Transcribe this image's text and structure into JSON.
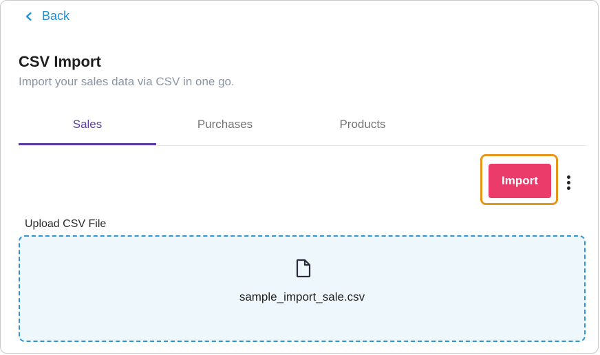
{
  "nav": {
    "back_label": "Back"
  },
  "header": {
    "title": "CSV Import",
    "subtitle": "Import your sales data via CSV in one go."
  },
  "tabs": [
    {
      "label": "Sales",
      "active": true
    },
    {
      "label": "Purchases",
      "active": false
    },
    {
      "label": "Products",
      "active": false
    }
  ],
  "toolbar": {
    "import_label": "Import",
    "more_icon": "more-vertical-icon"
  },
  "upload": {
    "label": "Upload CSV File",
    "file_icon": "file-icon",
    "file_name": "sample_import_sale.csv"
  },
  "colors": {
    "link": "#1f8fd6",
    "tab_active": "#5b3fa3",
    "primary_button": "#ea3b6b",
    "highlight": "#e8961a",
    "dropzone_bg": "#eef8fc",
    "dropzone_border": "#2d95d4"
  }
}
